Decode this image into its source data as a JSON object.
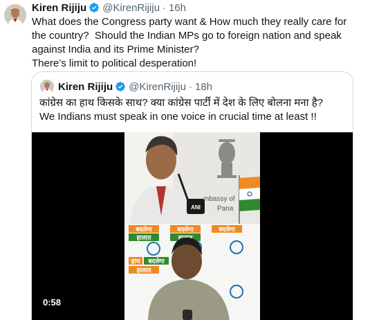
{
  "tweet": {
    "author_name": "Kiren Rijiju",
    "handle": "@KirenRijiju",
    "separator": "·",
    "time": "16h",
    "text": "What does the Congress party want & How much they really care for the country?  Should the Indian MPs go to foreign nation and speak against India and its Prime Minister?\nThere’s limit to political desperation!"
  },
  "quoted": {
    "author_name": "Kiren Rijiju",
    "handle": "@KirenRijiju",
    "separator": "·",
    "time": "18h",
    "text": "कांग्रेस का हाथ किसके साथ? क्या कांग्रेस पार्टी में देश के लिए बोलना मना है?\nWe Indians must speak in one voice in crucial time at least !!",
    "video": {
      "duration": "0:58",
      "mic_label": "ANI",
      "backdrop_text_1": "mbassy of",
      "backdrop_text_2": "Pana",
      "poster_text_1": "बदलेगा",
      "poster_text_2": "हालात",
      "poster_text_3": "हाथ"
    }
  },
  "colors": {
    "verified_blue": "#1d9bf0",
    "text_primary": "#0f1419",
    "text_secondary": "#536471",
    "border": "#cfd9de"
  }
}
